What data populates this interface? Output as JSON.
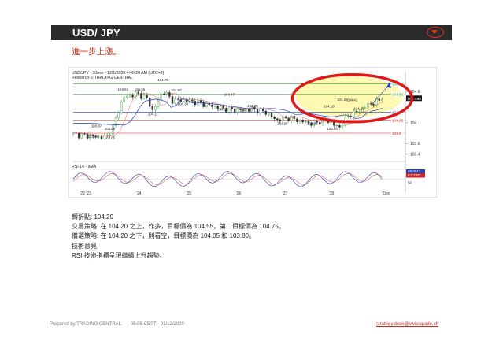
{
  "header": {
    "title": "USD/ JPY",
    "toggle_icon": "chevron-down-icon",
    "accent": "#e03020"
  },
  "subtitle": "進一步上漲。",
  "chart": {
    "info_line1": "USD/JPY - 30min - 12/1/2020 4:40:26 AM (UTC+2)",
    "info_line2": "Research © TRADING CENTRAL",
    "indicator_label": "RSI 14 - 9MA",
    "colors": {
      "bull": "#2a9a2a",
      "bear": "#cc2222",
      "ma_blue": "#1f3fbf",
      "ma_red": "#cc2222",
      "rsi": "#1f3fbf",
      "highlight": "#fff59a",
      "ellipse": "#e01818",
      "price_bg": "#1a1a1a"
    }
  },
  "chart_data": {
    "type": "candlestick",
    "instrument": "USD/JPY",
    "ylim": [
      103.3,
      104.8
    ],
    "y_ticks": [
      {
        "value": 104.6,
        "label": "104.6"
      },
      {
        "value": 104.0,
        "label": "104"
      },
      {
        "value": 103.6,
        "label": "103.6"
      },
      {
        "value": 103.4,
        "label": "103.4"
      }
    ],
    "x_ticks": [
      "'22 '23",
      "'24",
      "'25",
      "'26",
      "'27",
      "'29",
      "'Dec"
    ],
    "levels": [
      {
        "value": 104.75,
        "label": "104.7",
        "color": "#2a9a2a"
      },
      {
        "value": 104.55,
        "label": "104.55",
        "color": "#2a9a2a"
      },
      {
        "value": 104.2,
        "label": "104.2",
        "color": "#1f3fbf"
      },
      {
        "value": 104.05,
        "label": "104.05",
        "color": "#cc2222"
      },
      {
        "value": 103.8,
        "label": "103.8",
        "color": "#cc2222"
      }
    ],
    "current_price": "104.490",
    "annotations": [
      {
        "x": 0.07,
        "y": 103.91,
        "text": "103.87"
      },
      {
        "x": 0.06,
        "y": 103.71,
        "text": "103.61"
      },
      {
        "x": 0.11,
        "y": 103.86,
        "text": "103.85"
      },
      {
        "x": 0.11,
        "y": 103.69,
        "text": "103.65"
      },
      {
        "x": 0.15,
        "y": 104.62,
        "text": "104.61"
      },
      {
        "x": 0.2,
        "y": 104.62,
        "text": "104.66"
      },
      {
        "x": 0.27,
        "y": 104.8,
        "text": "104.76"
      },
      {
        "x": 0.24,
        "y": 104.14,
        "text": "104.11"
      },
      {
        "x": 0.31,
        "y": 104.6,
        "text": "104.50"
      },
      {
        "x": 0.33,
        "y": 104.34,
        "text": "104.38"
      },
      {
        "x": 0.47,
        "y": 104.52,
        "text": "104.47"
      },
      {
        "x": 0.45,
        "y": 104.23,
        "text": "104.23"
      },
      {
        "x": 0.52,
        "y": 104.21,
        "text": "104.19"
      },
      {
        "x": 0.54,
        "y": 104.3,
        "text": "104.28"
      },
      {
        "x": 0.63,
        "y": 103.96,
        "text": "103.98"
      },
      {
        "x": 0.72,
        "y": 103.96,
        "text": "103.95"
      },
      {
        "x": 0.77,
        "y": 104.29,
        "text": "104.18"
      },
      {
        "x": 0.81,
        "y": 104.42,
        "text": "104.36"
      },
      {
        "x": 0.84,
        "y": 104.41,
        "text": "104.41"
      },
      {
        "x": 0.78,
        "y": 103.86,
        "text": "103.80"
      },
      {
        "x": 0.86,
        "y": 104.25,
        "text": "104.22"
      }
    ],
    "rsi_levels": {
      "upper": "65.0612",
      "lower": "64.3362",
      "mid": "50"
    }
  },
  "notes": {
    "pivot_label": "轉折點",
    "pivot_value": "104.20",
    "strategy": "交易策略: 在 104.20 之上，作多，目標價為 104.55，第二目標價為 104.75。",
    "alternative": "備選策略: 在 104.20 之下，則看空，目標價為 104.05 和 103.80。",
    "comment_title": "技術意見",
    "comment": "RSI 技術指標呈現繼續上升趨勢。"
  },
  "footer": {
    "prepared_by": "Prepared by TRADING CENTRAL",
    "timestamp": "05:05 CEST - 01/12/2020",
    "email": "strategy.desk@swissquote.ch"
  }
}
